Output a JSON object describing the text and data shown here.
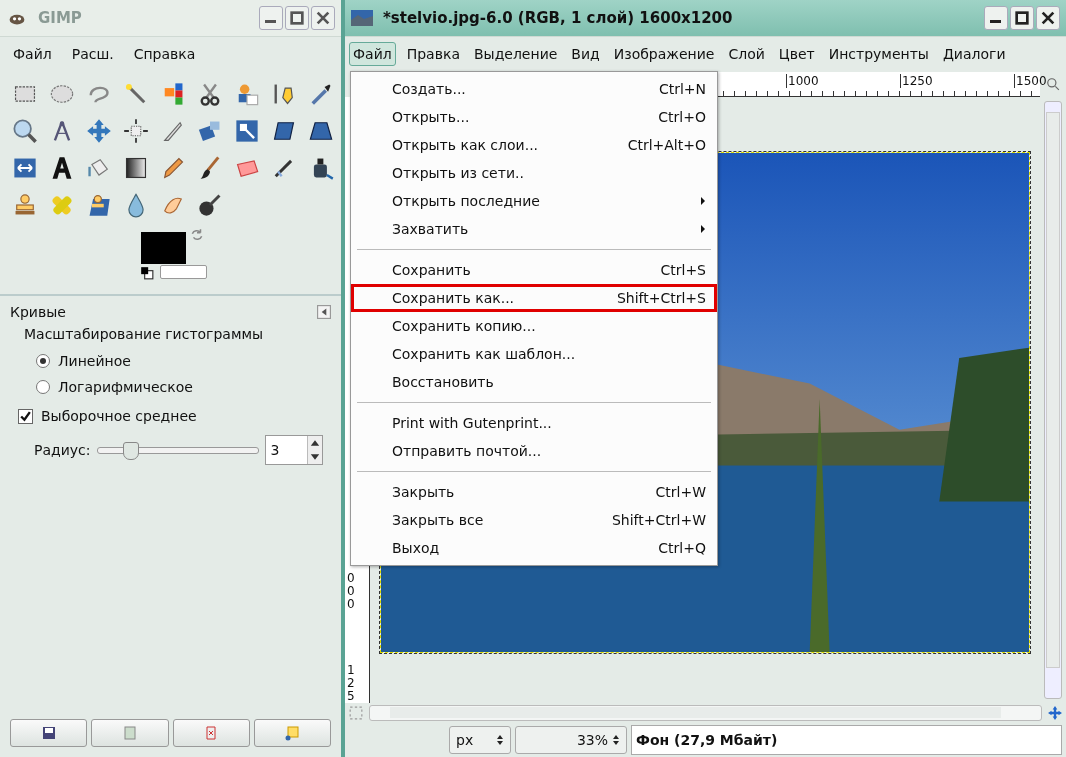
{
  "toolbox": {
    "title": "GIMP",
    "menu": [
      {
        "label": "Файл"
      },
      {
        "label": "Расш."
      },
      {
        "label": "Справка"
      }
    ],
    "tool_options": {
      "title": "Кривые",
      "group_label": "Масштабирование гистограммы",
      "radios": [
        {
          "label": "Линейное",
          "selected": true
        },
        {
          "label": "Логарифмическое",
          "selected": false
        }
      ],
      "checkbox": {
        "label": "Выборочное среднее",
        "checked": true
      },
      "radius": {
        "label": "Радиус:",
        "level": 0.2,
        "value": "3"
      }
    }
  },
  "image_window": {
    "title": "*stelvio.jpg-6.0 (RGB, 1 слой) 1600x1200",
    "menu": [
      {
        "label": "Файл",
        "selected": true
      },
      {
        "label": "Правка",
        "selected": false
      },
      {
        "label": "Выделение",
        "selected": false
      },
      {
        "label": "Вид",
        "selected": false
      },
      {
        "label": "Изображение",
        "selected": false
      },
      {
        "label": "Слой",
        "selected": false
      },
      {
        "label": "Цвет",
        "selected": false
      },
      {
        "label": "Инструменты",
        "selected": false
      },
      {
        "label": "Диалоги",
        "selected": false
      }
    ],
    "ruler_labels": [
      "1000",
      "1250",
      "1500"
    ],
    "vertical_ruler_labels": [
      "000",
      "125"
    ],
    "file_menu": [
      {
        "kind": "item",
        "label": "Создать...",
        "shortcut": "Ctrl+N",
        "submenu": false,
        "outlined": false
      },
      {
        "kind": "item",
        "label": "Открыть...",
        "shortcut": "Ctrl+O",
        "submenu": false,
        "outlined": false
      },
      {
        "kind": "item",
        "label": "Открыть как слои...",
        "shortcut": "Ctrl+Alt+O",
        "submenu": false,
        "outlined": false
      },
      {
        "kind": "item",
        "label": "Открыть из сети..",
        "submenu": false,
        "outlined": false
      },
      {
        "kind": "item",
        "label": "Открыть последние",
        "submenu": true,
        "outlined": false
      },
      {
        "kind": "item",
        "label": "Захватить",
        "submenu": true,
        "outlined": false
      },
      {
        "kind": "separator"
      },
      {
        "kind": "item",
        "label": "Сохранить",
        "shortcut": "Ctrl+S",
        "submenu": false,
        "outlined": false
      },
      {
        "kind": "item",
        "label": "Сохранить как...",
        "shortcut": "Shift+Ctrl+S",
        "submenu": false,
        "outlined": true
      },
      {
        "kind": "item",
        "label": "Сохранить копию...",
        "submenu": false,
        "outlined": false
      },
      {
        "kind": "item",
        "label": "Сохранить как шаблон...",
        "submenu": false,
        "outlined": false
      },
      {
        "kind": "item",
        "label": "Восстановить",
        "submenu": false,
        "outlined": false
      },
      {
        "kind": "separator"
      },
      {
        "kind": "item",
        "label": "Print with Gutenprint...",
        "submenu": false,
        "outlined": false
      },
      {
        "kind": "item",
        "label": "Отправить почтой...",
        "submenu": false,
        "outlined": false
      },
      {
        "kind": "separator"
      },
      {
        "kind": "item",
        "label": "Закрыть",
        "shortcut": "Ctrl+W",
        "submenu": false,
        "outlined": false
      },
      {
        "kind": "item",
        "label": "Закрыть все",
        "shortcut": "Shift+Ctrl+W",
        "submenu": false,
        "outlined": false
      },
      {
        "kind": "item",
        "label": "Выход",
        "shortcut": "Ctrl+Q",
        "submenu": false,
        "outlined": false
      }
    ],
    "status": {
      "unit": "px",
      "zoom": "33%",
      "layer": "Фон (27,9 Мбайт)"
    }
  }
}
